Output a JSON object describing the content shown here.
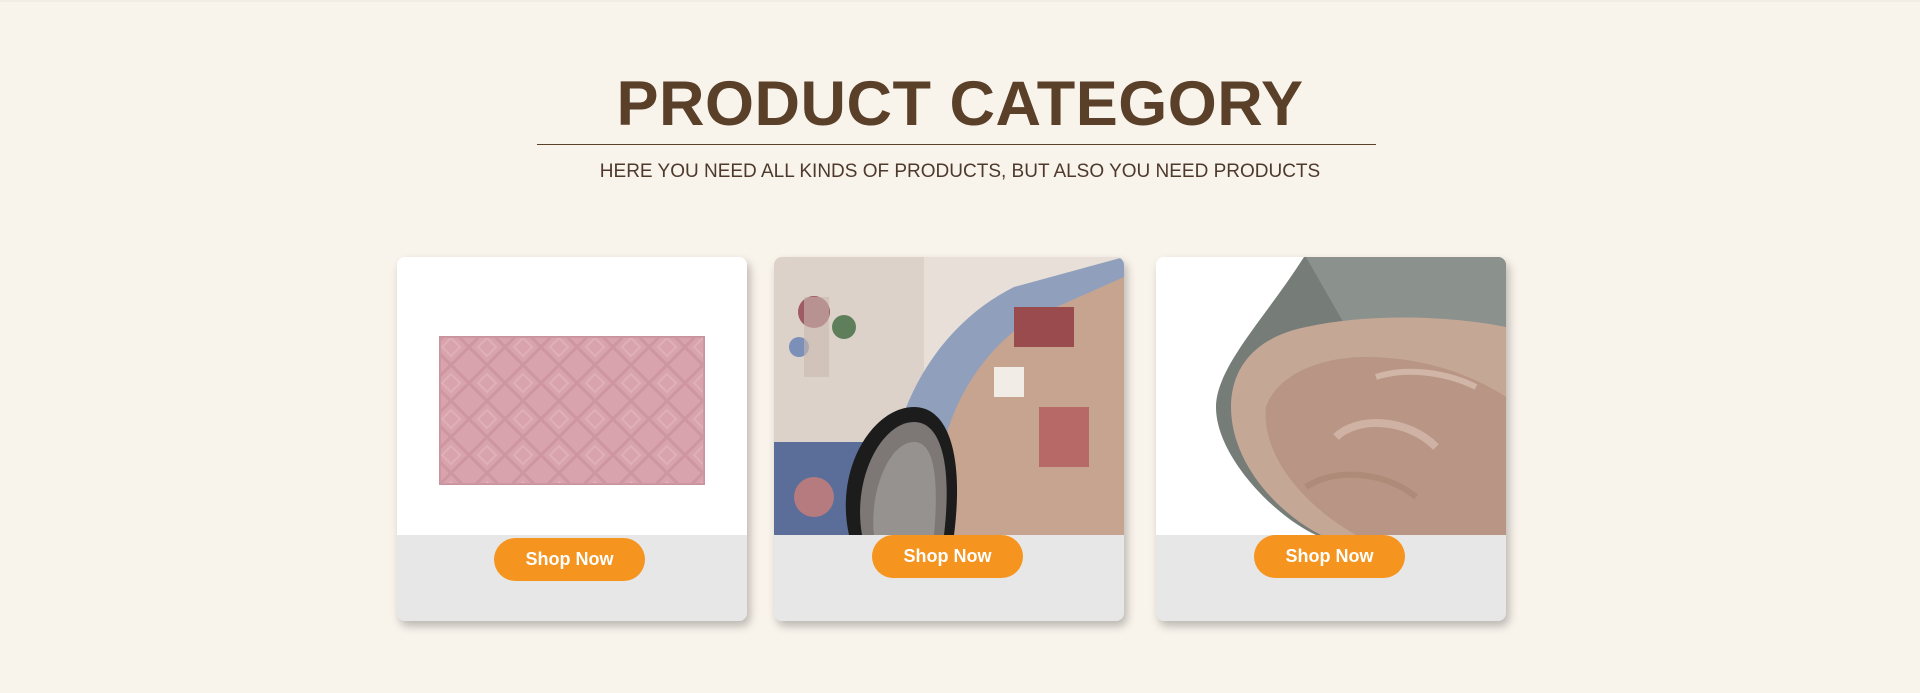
{
  "section": {
    "title": "PRODUCT CATEGORY",
    "subtitle": "HERE YOU NEED ALL KINDS OF PRODUCTS, BUT ALSO YOU NEED PRODUCTS"
  },
  "cards": [
    {
      "image": "pink-rug-image",
      "button_label": "Shop Now"
    },
    {
      "image": "persian-rug-image",
      "button_label": "Shop Now"
    },
    {
      "image": "gray-faux-fur-rug-image",
      "button_label": "Shop Now"
    }
  ],
  "colors": {
    "background": "#f8f3eb",
    "heading": "#5a3f29",
    "button": "#f5941e",
    "card_footer": "#e7e7e7"
  }
}
